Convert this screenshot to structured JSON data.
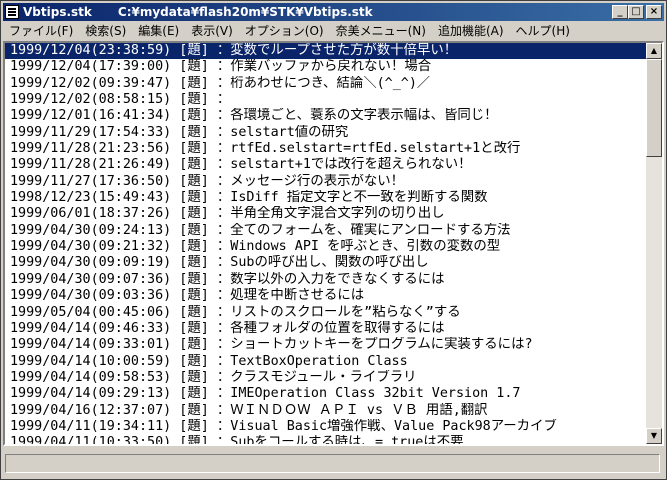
{
  "window": {
    "title_name": "Vbtips.stk",
    "title_path": "C:¥mydata¥flash20m¥STK¥Vbtips.stk",
    "minimize": "_",
    "maximize": "□",
    "close": "×"
  },
  "menu": [
    {
      "label": "ファイル(F)"
    },
    {
      "label": "検索(S)"
    },
    {
      "label": "編集(E)"
    },
    {
      "label": "表示(V)"
    },
    {
      "label": "オプション(O)"
    },
    {
      "label": "奈美メニュー(N)"
    },
    {
      "label": "追加機能(A)"
    },
    {
      "label": "ヘルプ(H)"
    }
  ],
  "rows": [
    "1999/12/04(23:38:59) [題] ：変数でループさせた方が数十倍早い！",
    "1999/12/04(17:39:00) [題] ：作業バッファから戻れない！場合",
    "1999/12/02(09:39:47) [題] ：桁あわせにつき、結論＼(^_^)／",
    "1999/12/02(08:58:15) [題] ：",
    "1999/12/01(16:41:34) [題] ：各環境ごと、蓑系の文字表示幅は、皆同じ！",
    "1999/11/29(17:54:33) [題] ：selstart値の研究",
    "1999/11/28(21:23:56) [題] ：rtfEd.selstart=rtfEd.selstart+1と改行",
    "1999/11/28(21:26:49) [題] ：selstart+1では改行を超えられない！",
    "1999/11/27(17:36:50) [題] ：メッセージ行の表示がない！",
    "1998/12/23(15:49:43) [題] ：IsDiff 指定文字と不一致を判断する関数",
    "1999/06/01(18:37:26) [題] ：半角全角文字混合文字列の切り出し",
    "1999/04/30(09:24:13) [題] ：全てのフォームを、確実にアンロードする方法",
    "1999/04/30(09:21:32) [題] ：Windows API を呼ぶとき、引数の変数の型",
    "1999/04/30(09:09:19) [題] ：Subの呼び出し、関数の呼び出し",
    "1999/04/30(09:07:36) [題] ：数字以外の入力をできなくするには",
    "1999/04/30(09:03:36) [題] ：処理を中断させるには",
    "1999/05/04(00:45:06) [題] ：リストのスクロールを”粘らなく”する",
    "1999/04/14(09:46:33) [題] ：各種フォルダの位置を取得するには",
    "1999/04/14(09:33:01) [題] ：ショートカットキーをプログラムに実装するには?",
    "1999/04/14(10:00:59) [題] ：TextBoxOperation Class",
    "1999/04/14(09:58:53) [題] ：クラスモジュール・ライブラリ",
    "1999/04/14(09:29:13) [題] ：IMEOperation Class 32bit Version 1.7",
    "1999/04/16(12:37:07) [題] ：ＷＩＮＤＯＷ ＡＰＩ vs ＶＢ 用語,翻訳",
    "1999/04/11(19:34:11) [題] ：Visual Basic増強作戦、Value Pack98アーカイブ",
    "1999/04/11(10:33:50) [題] ：Subをコールする時は、= trueは不要"
  ],
  "scrollbar": {
    "up": "▲",
    "down": "▼"
  },
  "status": {
    "text": ""
  },
  "colors": {
    "selection": "#0a246a",
    "titlebar": "#0a246a",
    "face": "#d4d0c8"
  }
}
